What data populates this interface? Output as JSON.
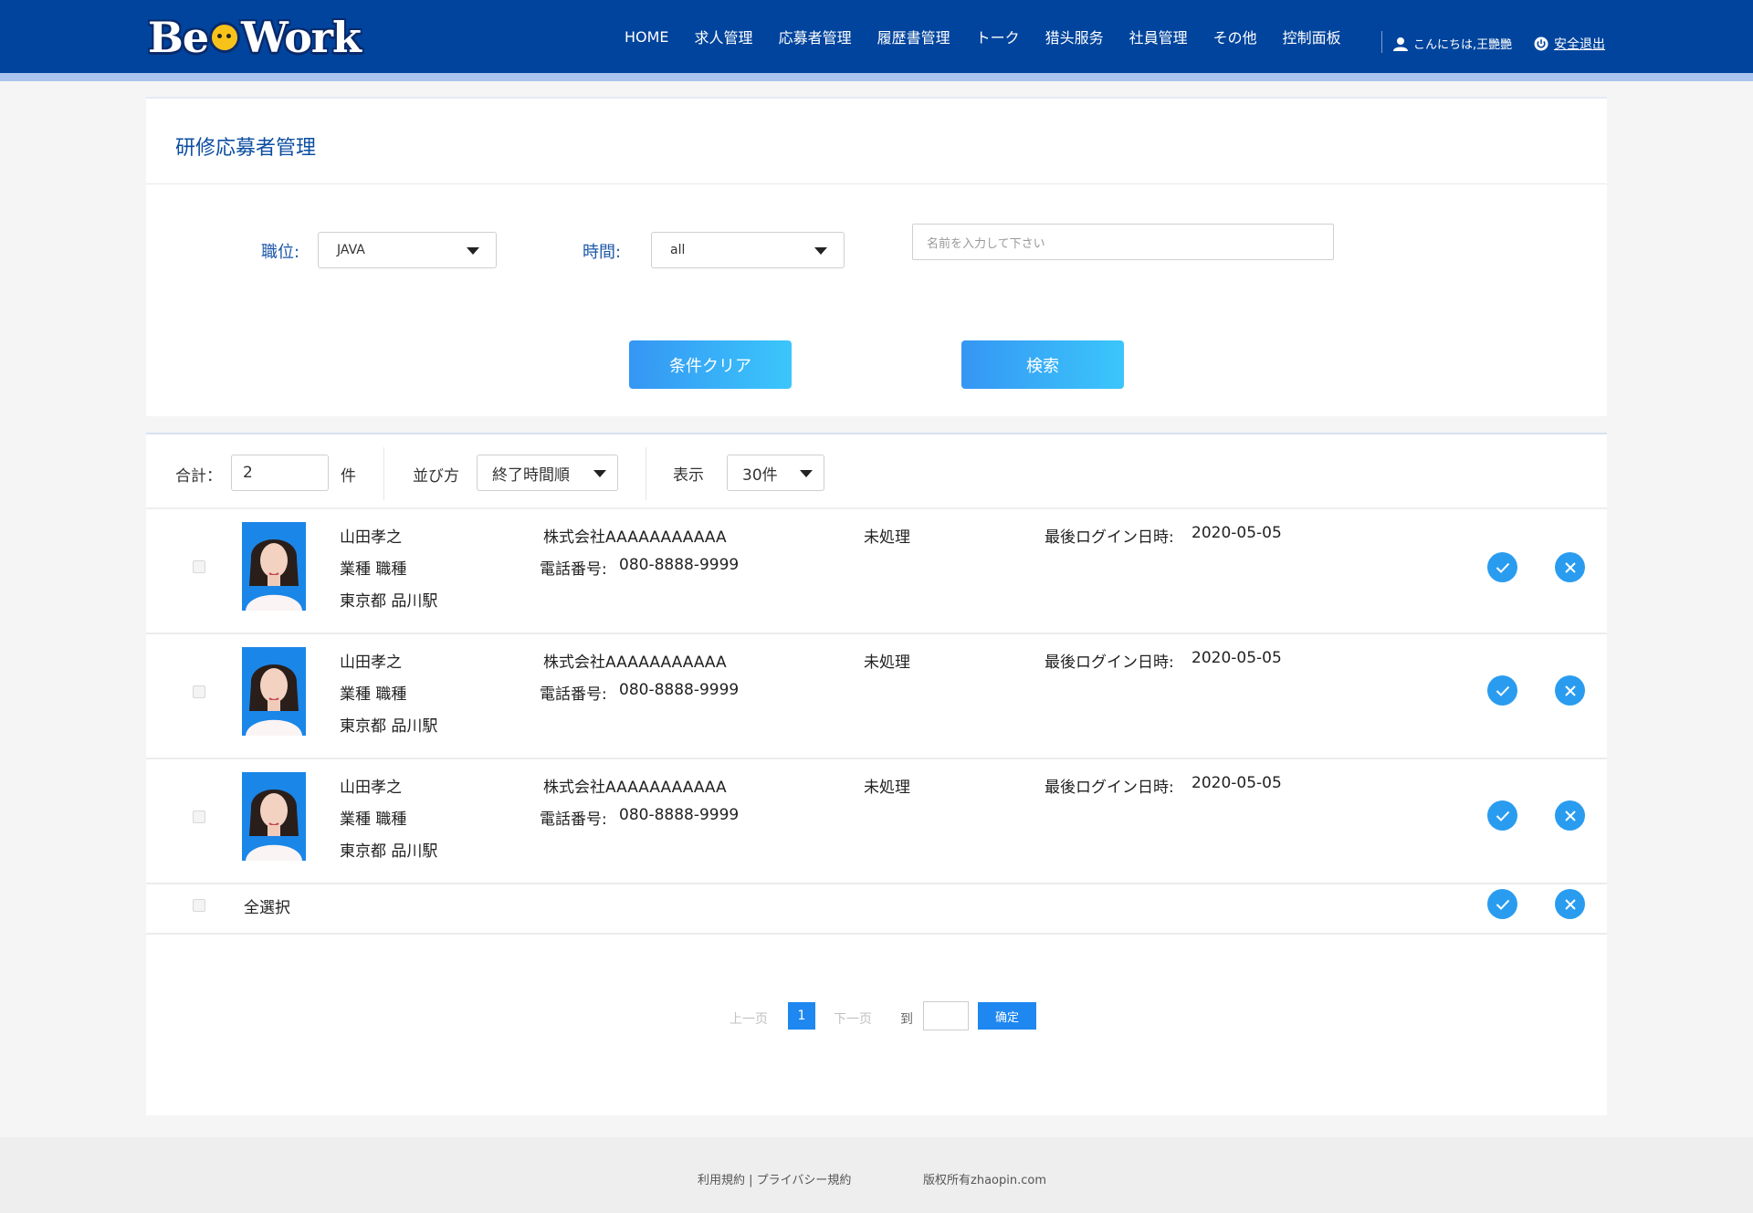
{
  "header": {
    "logo_text": "BeeWork",
    "nav": [
      "HOME",
      "求人管理",
      "応募者管理",
      "履歴書管理",
      "トーク",
      "猎头服务",
      "社員管理",
      "その他",
      "控制面板"
    ],
    "user_greeting": "こんにちは,王艷艷",
    "logout_label": "安全退出"
  },
  "page": {
    "title": "研修応募者管理"
  },
  "filters": {
    "position_label": "職位:",
    "position_value": "JAVA",
    "time_label": "時間:",
    "time_value": "all",
    "name_placeholder": "名前を入力して下さい",
    "clear_label": "条件クリア",
    "search_label": "検索"
  },
  "toolbar": {
    "total_label": "合計：",
    "total_value": "2",
    "unit": "件",
    "sort_label": "並び方",
    "sort_value": "終了時間順",
    "display_label": "表示",
    "display_value": "30件"
  },
  "rows": [
    {
      "name": "山田孝之",
      "job": "業種 職種",
      "location": "東京都 品川駅",
      "company": "株式会社AAAAAAAAAAA",
      "phone_label": "電話番号:",
      "phone": "080-8888-9999",
      "status": "未処理",
      "last_login_label": "最後ログイン日時:",
      "last_login": "2020-05-05"
    },
    {
      "name": "山田孝之",
      "job": "業種 職種",
      "location": "東京都 品川駅",
      "company": "株式会社AAAAAAAAAAA",
      "phone_label": "電話番号:",
      "phone": "080-8888-9999",
      "status": "未処理",
      "last_login_label": "最後ログイン日時:",
      "last_login": "2020-05-05"
    },
    {
      "name": "山田孝之",
      "job": "業種 職種",
      "location": "東京都 品川駅",
      "company": "株式会社AAAAAAAAAAA",
      "phone_label": "電話番号:",
      "phone": "080-8888-9999",
      "status": "未処理",
      "last_login_label": "最後ログイン日時:",
      "last_login": "2020-05-05"
    }
  ],
  "select_all_label": "全選択",
  "pagination": {
    "prev": "上一页",
    "current": "1",
    "next": "下一页",
    "goto": "到",
    "confirm": "确定"
  },
  "footer": {
    "terms": "利用規約 | プライバシー規約",
    "copyright": "版权所有zhaopin.com"
  },
  "colors": {
    "header": "#00449d",
    "accent": "#2a9cf0",
    "title": "#0c4ea2"
  }
}
